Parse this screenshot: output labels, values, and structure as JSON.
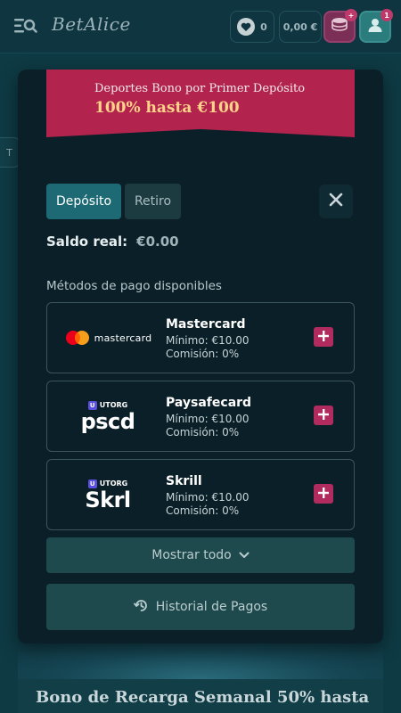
{
  "header": {
    "logo": "BetAlice",
    "favorites_count": "0",
    "balance": "0,00 €",
    "notifications_count": "1"
  },
  "side_tab": {
    "label": "T"
  },
  "modal": {
    "banner": {
      "subtitle": "Deportes Bono por Primer Depósito",
      "title": "100% hasta €100"
    },
    "tabs": [
      {
        "label": "Depósito",
        "active": true
      },
      {
        "label": "Retiro",
        "active": false
      }
    ],
    "balance": {
      "label": "Saldo real:",
      "value": "€0.00"
    },
    "methods_label": "Métodos de pago disponibles",
    "methods": [
      {
        "name": "Mastercard",
        "min": "Mínimo: €10.00",
        "fee": "Comisión: 0%",
        "logo_text": "mastercard",
        "icon": "mastercard-logo"
      },
      {
        "name": "Paysafecard",
        "min": "Mínimo: €10.00",
        "fee": "Comisión: 0%",
        "logo_brand": "UTORG",
        "logo_text": "pscd",
        "icon": "paysafecard-logo"
      },
      {
        "name": "Skrill",
        "min": "Mínimo: €10.00",
        "fee": "Comisión: 0%",
        "logo_brand": "UTORG",
        "logo_text": "Skrl",
        "icon": "skrill-logo"
      }
    ],
    "show_all": "Mostrar todo",
    "history": "Historial de Pagos"
  },
  "background_promo": {
    "title": "Bono de Recarga Semanal 50% hasta"
  },
  "colors": {
    "accent": "#b2244e",
    "banner_gold": "#ffd28a",
    "tab_active": "#1d6a74",
    "modal_bg": "#0b1f28"
  }
}
